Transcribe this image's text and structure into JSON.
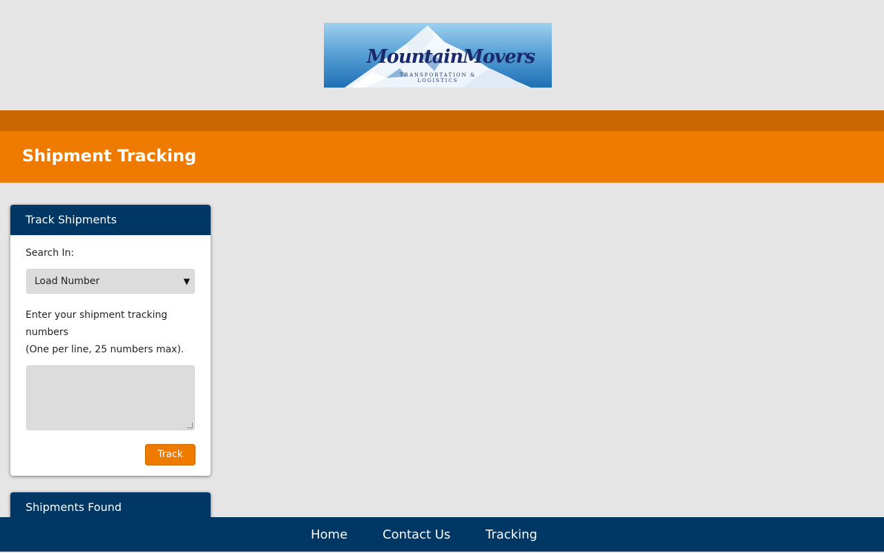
{
  "logo": {
    "name": "MountainMovers",
    "tagline": "TRANSPORTATION & LOGISTICS"
  },
  "page": {
    "title": "Shipment Tracking"
  },
  "track_panel": {
    "heading": "Track Shipments",
    "search_label": "Search In:",
    "search_selected": "Load Number",
    "instructions_line1": "Enter your shipment tracking",
    "instructions_line2": "numbers",
    "instructions_line3": "(One per line, 25 numbers max).",
    "textarea_value": "",
    "track_button": "Track"
  },
  "found_panel": {
    "heading": "Shipments Found"
  },
  "footer": {
    "links": [
      "Home",
      "Contact Us",
      "Tracking"
    ]
  },
  "colors": {
    "navy": "#003765",
    "orange": "#ef7a00",
    "dark_orange": "#cb6600",
    "background": "#e5e5e5"
  }
}
